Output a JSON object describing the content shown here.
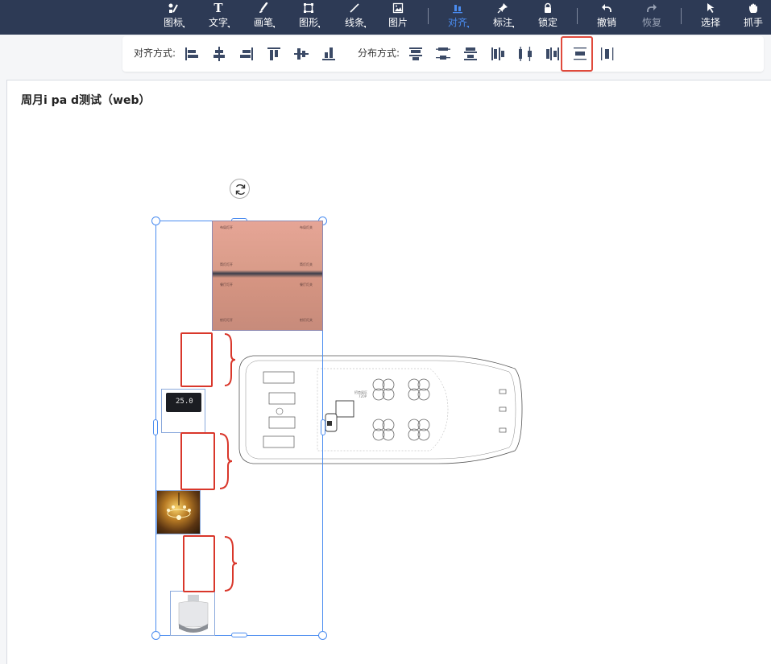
{
  "toolbar": {
    "items": [
      {
        "label": "图标",
        "icon": "icon-library-icon"
      },
      {
        "label": "文字",
        "icon": "text-icon"
      },
      {
        "label": "画笔",
        "icon": "brush-icon"
      },
      {
        "label": "图形",
        "icon": "shape-icon"
      },
      {
        "label": "线条",
        "icon": "line-icon"
      },
      {
        "label": "图片",
        "icon": "image-icon"
      },
      {
        "label": "对齐",
        "icon": "align-icon",
        "active": true
      },
      {
        "label": "标注",
        "icon": "pin-icon"
      },
      {
        "label": "锁定",
        "icon": "lock-icon"
      },
      {
        "label": "撤销",
        "icon": "undo-icon"
      },
      {
        "label": "恢复",
        "icon": "redo-icon",
        "disabled": true
      },
      {
        "label": "选择",
        "icon": "cursor-icon"
      },
      {
        "label": "抓手",
        "icon": "hand-icon"
      }
    ],
    "text_icon_glyph": "T"
  },
  "alignbar": {
    "align_label": "对齐方式:",
    "distribute_label": "分布方式:",
    "highlighted": "distribute-vertical-equal"
  },
  "canvas": {
    "title": "周月i pa d测试（web）"
  },
  "panel_image": {
    "labels": [
      "布局灯开",
      "布局灯关",
      "筒灯灯开",
      "筒灯灯关",
      "餐厅灯开",
      "餐厅灯关",
      "射灯灯开",
      "射灯灯关"
    ]
  },
  "thermostat": {
    "display": "25.0"
  },
  "floorplan": {
    "room_label": "招商展区",
    "room_sub": "720P"
  },
  "colors": {
    "toolbar_bg": "#2d3a55",
    "accent": "#4a8cf0",
    "selection": "#4a8cf0",
    "annotation_red": "#d9372b"
  }
}
